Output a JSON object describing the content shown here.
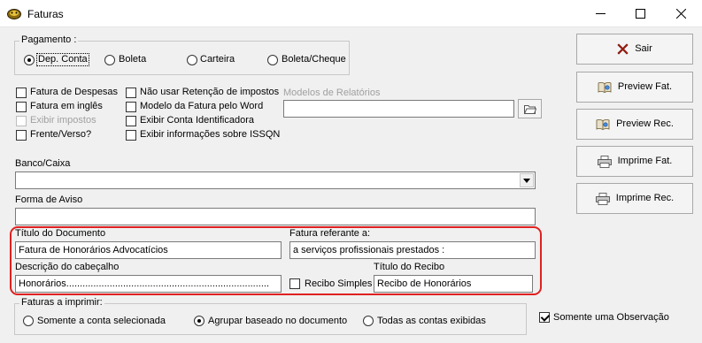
{
  "window": {
    "title": "Faturas"
  },
  "pagamento": {
    "label": "Pagamento :",
    "options": [
      "Dep. Conta",
      "Boleta",
      "Carteira",
      "Boleta/Cheque"
    ],
    "selected": "Dep. Conta"
  },
  "checkboxes": {
    "fatura_despesas": "Fatura de Despesas",
    "fatura_ingles": "Fatura em inglês",
    "exibir_impostos": "Exibir impostos",
    "frente_verso": "Frente/Verso?",
    "nao_usar_retencao": "Não usar Retenção de impostos",
    "modelo_word": "Modelo da Fatura pelo Word",
    "exibir_conta": "Exibir Conta Identificadora",
    "exibir_issqn": "Exibir informações sobre ISSQN"
  },
  "modelos": {
    "label": "Modelos de Relatórios",
    "value": ""
  },
  "banco": {
    "label": "Banco/Caixa",
    "value": ""
  },
  "forma_aviso": {
    "label": "Forma de Aviso",
    "value": ""
  },
  "titulo_documento": {
    "label": "Título do Documento",
    "value": "Fatura de Honorários Advocatícios"
  },
  "fatura_referente": {
    "label": "Fatura referante a:",
    "value": "a serviços profissionais prestados :"
  },
  "descricao_cabecalho": {
    "label": "Descrição do cabeçalho",
    "value": "Honorários..........................................................................."
  },
  "recibo_simples": {
    "label": "Recibo Simples"
  },
  "titulo_recibo": {
    "label": "Título do Recibo",
    "value": "Recibo de Honorários"
  },
  "faturas_imprimir": {
    "label": "Faturas a imprimir:",
    "options": [
      "Somente a conta selecionada",
      "Agrupar baseado no documento",
      "Todas as contas exibidas"
    ],
    "selected": "Agrupar baseado no documento"
  },
  "somente_observacao": {
    "label": "Somente uma Observação",
    "checked": true
  },
  "buttons": {
    "sair": "Sair",
    "preview_fat": "Preview Fat.",
    "preview_rec": "Preview Rec.",
    "imprime_fat": "Imprime Fat.",
    "imprime_rec": "Imprime Rec."
  },
  "colors": {
    "highlight": "#e02020",
    "exit_icon": "#c0281c"
  }
}
